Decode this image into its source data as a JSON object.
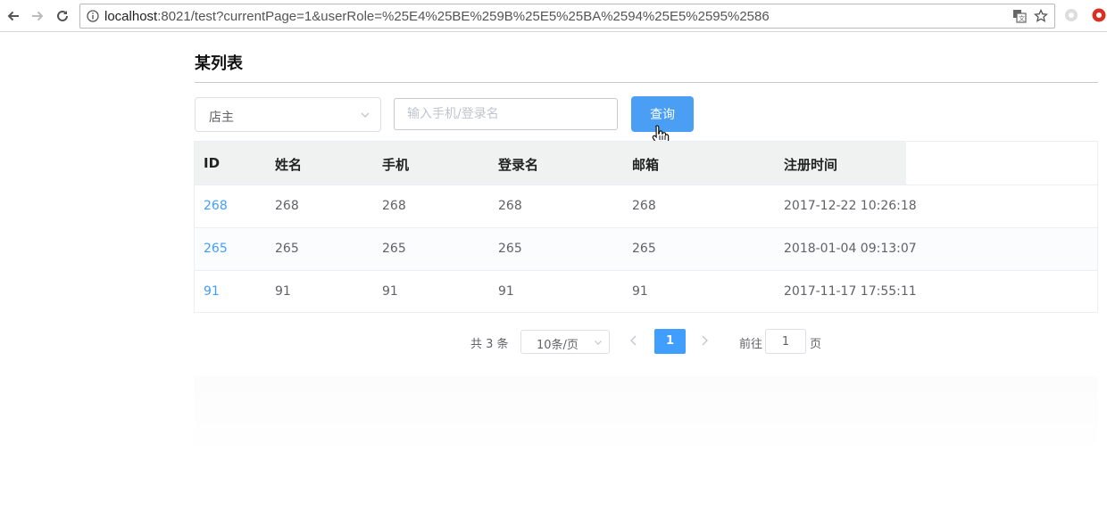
{
  "browser": {
    "url_host": "localhost",
    "url_rest": ":8021/test?currentPage=1&userRole=%25E4%25BE%259B%25E5%25BA%2594%25E5%2595%2586",
    "icons": [
      "back-arrow-icon",
      "forward-arrow-icon",
      "reload-icon",
      "info-icon",
      "translate-icon",
      "star-icon",
      "extension-icon",
      "extension-red-icon"
    ]
  },
  "page": {
    "title": "某列表"
  },
  "filters": {
    "role_value": "店主",
    "search_placeholder": "输入手机/登录名",
    "search_value": "",
    "query_label": "查询"
  },
  "table": {
    "headers": [
      "ID",
      "姓名",
      "手机",
      "登录名",
      "邮箱",
      "注册时间"
    ],
    "rows": [
      {
        "id": "268",
        "name": "268",
        "phone": "268",
        "login": "268",
        "email": "268",
        "registered": "2017-12-22 10:26:18"
      },
      {
        "id": "265",
        "name": "265",
        "phone": "265",
        "login": "265",
        "email": "265",
        "registered": "2018-01-04 09:13:07"
      },
      {
        "id": "91",
        "name": "91",
        "phone": "91",
        "login": "91",
        "email": "91",
        "registered": "2017-11-17 17:55:11"
      }
    ]
  },
  "pagination": {
    "total_text": "共 3 条",
    "page_size": "10条/页",
    "current_page": "1",
    "goto_label": "前往",
    "goto_value": "1",
    "goto_unit": "页"
  },
  "colors": {
    "accent": "#409eff",
    "button": "#4a9ff5"
  }
}
